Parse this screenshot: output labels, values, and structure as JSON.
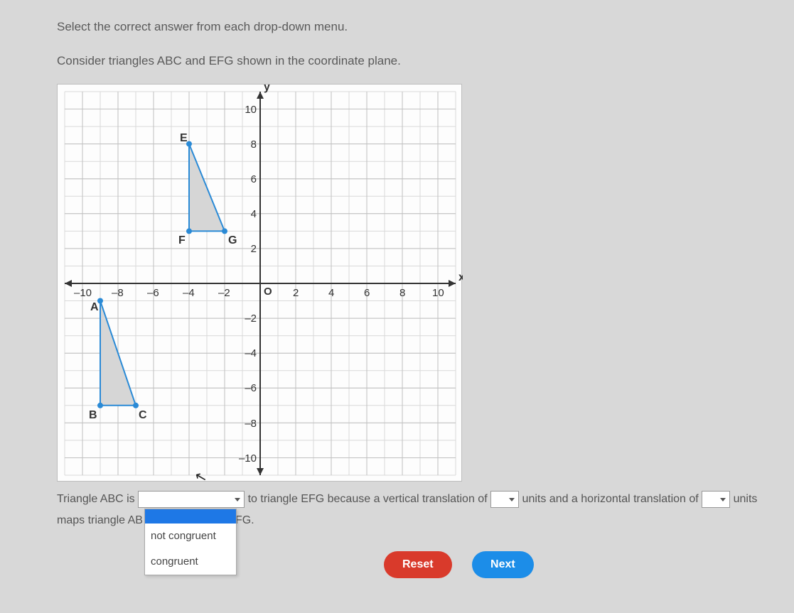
{
  "instruction": "Select the correct answer from each drop-down menu.",
  "prompt": "Consider triangles ABC and EFG shown in the coordinate plane.",
  "chart_data": {
    "type": "scatter",
    "title": "",
    "xlabel": "x",
    "ylabel": "y",
    "xlim": [
      -11,
      11
    ],
    "ylim": [
      -11,
      11
    ],
    "x_ticks": [
      -10,
      -8,
      -6,
      -4,
      -2,
      2,
      4,
      6,
      8,
      10
    ],
    "y_ticks": [
      -10,
      -8,
      -6,
      -4,
      -2,
      2,
      4,
      6,
      8,
      10
    ],
    "origin_label": "O",
    "triangles": [
      {
        "name": "ABC",
        "vertices": {
          "A": [
            -9,
            -1
          ],
          "B": [
            -9,
            -7
          ],
          "C": [
            -7,
            -7
          ]
        },
        "fill": "#d6d6d6",
        "stroke": "#2a8ad6"
      },
      {
        "name": "EFG",
        "vertices": {
          "E": [
            -4,
            8
          ],
          "F": [
            -4,
            3
          ],
          "G": [
            -2,
            3
          ]
        },
        "fill": "#d6d6d6",
        "stroke": "#2a8ad6"
      }
    ]
  },
  "fill": {
    "pre1": "Triangle ABC is ",
    "mid1": " to triangle EFG because a vertical translation of ",
    "mid2": " units and a horizontal translation of ",
    "mid3": " units",
    "line2a": "maps triangle AB",
    "line2b": "FG."
  },
  "dropdown1": {
    "open": true,
    "selected_blank": "",
    "options": [
      "not congruent",
      "congruent"
    ]
  },
  "dropdown2": {
    "value": ""
  },
  "dropdown3": {
    "value": ""
  },
  "buttons": {
    "reset": "Reset",
    "next": "Next"
  }
}
